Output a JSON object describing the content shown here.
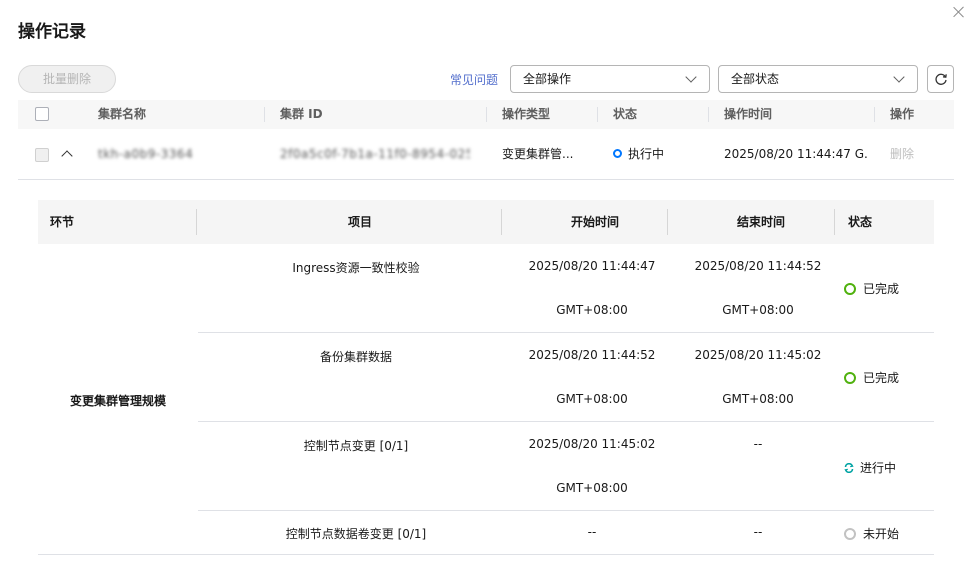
{
  "dialog": {
    "title": "操作记录"
  },
  "toolbar": {
    "batch_delete_label": "批量删除",
    "faq_label": "常见问题",
    "operation_filter_value": "全部操作",
    "status_filter_value": "全部状态"
  },
  "table": {
    "headers": [
      "集群名称",
      "集群 ID",
      "操作类型",
      "状态",
      "操作时间",
      "操作"
    ],
    "row": {
      "cluster_name": "tkh-a0b9-3364",
      "cluster_id": "2f0a5c0f-7b1a-11f0-8954-0255ac...",
      "operation_type": "变更集群管...",
      "status": "执行中",
      "operation_time": "2025/08/20 11:44:47 G...",
      "action": "删除"
    }
  },
  "detail": {
    "headers": [
      "环节",
      "项目",
      "开始时间",
      "结束时间",
      "状态"
    ],
    "phase": "变更集群管理规模",
    "steps": [
      {
        "item": "Ingress资源一致性校验",
        "start": "2025/08/20 11:44:47",
        "start_tz": "GMT+08:00",
        "end": "2025/08/20 11:44:52",
        "end_tz": "GMT+08:00",
        "status": "已完成"
      },
      {
        "item": "备份集群数据",
        "start": "2025/08/20 11:44:52",
        "start_tz": "GMT+08:00",
        "end": "2025/08/20 11:45:02",
        "end_tz": "GMT+08:00",
        "status": "已完成"
      },
      {
        "item": "控制节点变更  [0/1]",
        "start": "2025/08/20 11:45:02",
        "start_tz": "GMT+08:00",
        "end": "--",
        "end_tz": "",
        "status": "进行中"
      },
      {
        "item": "控制节点数据卷变更  [0/1]",
        "start": "--",
        "start_tz": "",
        "end": "--",
        "end_tz": "",
        "status": "未开始"
      }
    ]
  },
  "colors": {
    "link": "#526ecc",
    "running": "#0077ff",
    "done": "#50b10e",
    "progress": "#00a3a3",
    "waiting": "#c2c2c2"
  }
}
